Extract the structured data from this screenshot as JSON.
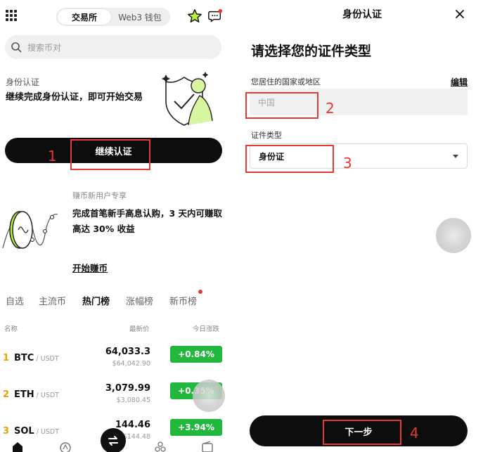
{
  "left": {
    "segment": {
      "tabs": [
        "交易所",
        "Web3 钱包"
      ],
      "active": "交易所"
    },
    "search": {
      "placeholder": "搜索币对"
    },
    "verify": {
      "label": "身份认证",
      "text": "继续完成身份认证，即可开始交易",
      "button": "继续认证"
    },
    "earn": {
      "tag": "赚币新用户专享",
      "text": "完成首笔新手高息认购，3 天内可赚取高达 30% 收益",
      "link": "开始赚币"
    },
    "market_tabs": [
      "自选",
      "主流币",
      "热门榜",
      "涨幅榜",
      "新币榜"
    ],
    "market_active": "热门榜",
    "columns": {
      "name": "名称",
      "price": "最新价",
      "change": "今日涨跌"
    },
    "rows": [
      {
        "rank": "1",
        "symbol": "BTC",
        "quote": " / USDT",
        "price": "64,033.3",
        "price_fiat": "$64,042.90",
        "change": "+0.84%"
      },
      {
        "rank": "2",
        "symbol": "ETH",
        "quote": " / USDT",
        "price": "3,079.99",
        "price_fiat": "$3,080.45",
        "change": "+0.35%"
      },
      {
        "rank": "3",
        "symbol": "SOL",
        "quote": " / USDT",
        "price": "144.46",
        "price_fiat": "$144.48",
        "change": "+3.94%"
      }
    ],
    "annotations": {
      "n1": "1"
    }
  },
  "right": {
    "title": "身份认证",
    "heading": "请选择您的证件类型",
    "country_label": "您居住的国家或地区",
    "edit": "编辑",
    "country_value": "中国",
    "doc_type_label": "证件类型",
    "doc_type_value": "身份证",
    "next_button": "下一步",
    "annotations": {
      "n2": "2",
      "n3": "3",
      "n4": "4"
    }
  },
  "colors": {
    "accent_green": "#21b83d",
    "lime": "#b8f03c",
    "primary_button": "#0d0d0d",
    "rank_gold": "#e8a200",
    "annotation_red": "#e53935"
  },
  "icons": {
    "grid": "grid-menu-icon",
    "favorite": "star-icon",
    "messages": "chat-icon",
    "search": "search-icon",
    "close": "close-icon",
    "dropdown": "caret-down-icon",
    "swap": "swap-icon"
  }
}
